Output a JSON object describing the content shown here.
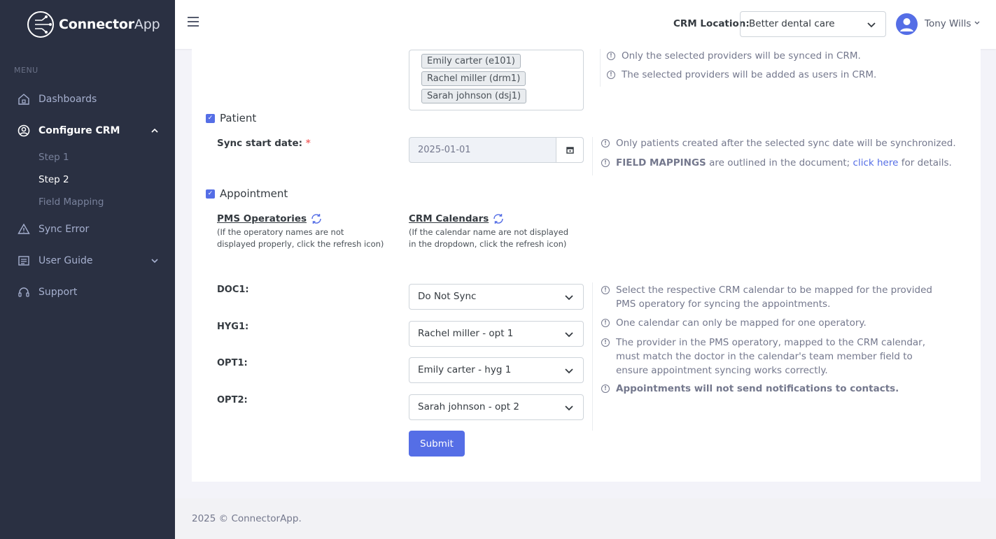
{
  "brand": {
    "name_bold": "Connector",
    "name_light": "App"
  },
  "sidebar": {
    "menu_title": "MENU",
    "items": [
      {
        "label": "Dashboards",
        "icon": "home-icon"
      },
      {
        "label": "Configure CRM",
        "icon": "user-circle-icon",
        "active": true
      },
      {
        "label": "Sync Error",
        "icon": "warning-icon"
      },
      {
        "label": "User Guide",
        "icon": "document-icon"
      },
      {
        "label": "Support",
        "icon": "headset-icon"
      }
    ],
    "subitems": [
      "Step 1",
      "Step 2",
      "Field Mapping"
    ]
  },
  "header": {
    "crm_location_label": "CRM Location:",
    "crm_location_value": "Better dental care",
    "user_name": "Tony Wills"
  },
  "providers": {
    "tags": [
      "Emily carter (e101)",
      "Rachel miller (drm1)",
      "Sarah johnson (dsj1)"
    ],
    "notes": [
      "Only the selected providers will be synced in CRM.",
      "The selected providers will be added as users in CRM."
    ]
  },
  "patient": {
    "label": "Patient",
    "sync_label": "Sync start date:",
    "required_mark": "*",
    "sync_date": "2025-01-01",
    "note1": "Only patients created after the selected sync date will be synchronized.",
    "note2_bold": "FIELD MAPPINGS",
    "note2_mid": " are outlined in the document; ",
    "note2_link": "click here",
    "note2_end": " for details."
  },
  "appointment": {
    "label": "Appointment",
    "pms_heading": "PMS Operatories",
    "pms_sub": "(If the operatory names are not displayed properly, click the refresh icon)",
    "crm_heading": "CRM Calendars",
    "crm_sub": "(If the calendar name are not displayed in the dropdown, click the refresh icon)",
    "rows": [
      {
        "op": "DOC1:",
        "value": "Do Not Sync"
      },
      {
        "op": "HYG1:",
        "value": "Rachel miller - opt 1"
      },
      {
        "op": "OPT1:",
        "value": "Emily carter - hyg 1"
      },
      {
        "op": "OPT2:",
        "value": "Sarah johnson - opt 2"
      }
    ],
    "notes": [
      "Select the respective CRM calendar to be mapped for the provided PMS operatory for syncing the appointments.",
      "One calendar can only be mapped for one operatory.",
      "The provider in the PMS operatory, mapped to the CRM calendar, must match the doctor in the calendar's team member field to ensure appointment syncing works correctly.",
      "Appointments will not send notifications to contacts."
    ],
    "submit_label": "Submit"
  },
  "footer": {
    "text": "2025 © ConnectorApp."
  },
  "colors": {
    "sidebar": "#2a3042",
    "accent": "#556ee6",
    "background": "#f3f3f9"
  }
}
